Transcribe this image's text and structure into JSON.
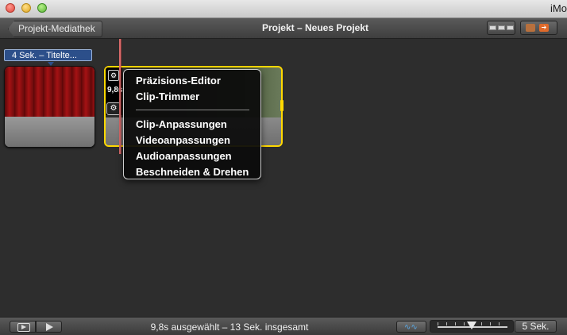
{
  "window": {
    "app_name": "iMo"
  },
  "toolbar": {
    "back_label": "Projekt-Mediathek",
    "project_title": "Projekt – Neues Projekt"
  },
  "timeline": {
    "title_tag": "4 Sek. – Titelte...",
    "selected_clip_duration": "9,8s"
  },
  "context_menu": {
    "group1": [
      "Präzisions-Editor",
      "Clip-Trimmer"
    ],
    "group2": [
      "Clip-Anpassungen",
      "Videoanpassungen",
      "Audioanpassungen",
      "Beschneiden & Drehen"
    ]
  },
  "bottombar": {
    "status": "9,8s ausgewählt – 13 Sek. insgesamt",
    "zoom_label": "5 Sek."
  },
  "icons": {
    "gear": "⚙",
    "waveform": "∿∿"
  },
  "colors": {
    "selection": "#ffd800",
    "title_tag": "#2c4f8a",
    "playhead": "#d96a6a"
  }
}
